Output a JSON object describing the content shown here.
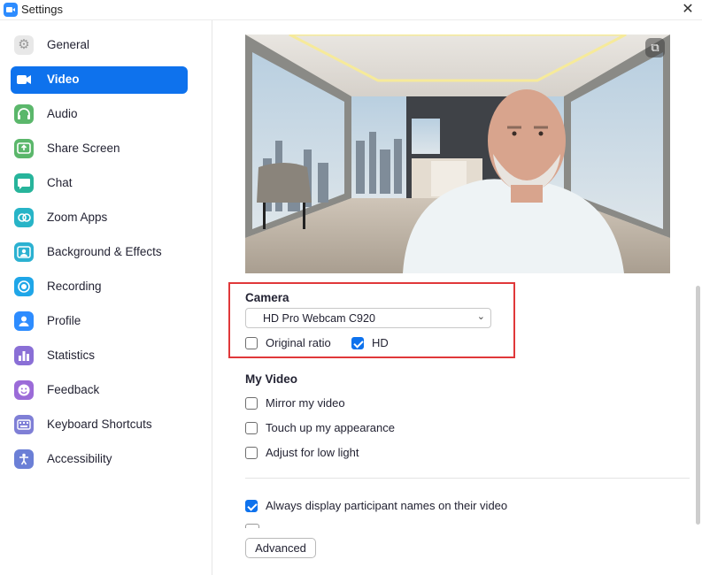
{
  "window": {
    "title": "Settings"
  },
  "sidebar": {
    "items": [
      {
        "label": "General",
        "icon": "gear-icon",
        "color": "#e8e8e8",
        "active": false
      },
      {
        "label": "Video",
        "icon": "video-camera-icon",
        "color": "#0e72ed",
        "active": true
      },
      {
        "label": "Audio",
        "icon": "headphones-icon",
        "color": "#5bb76b",
        "active": false
      },
      {
        "label": "Share Screen",
        "icon": "share-screen-icon",
        "color": "#5bb76b",
        "active": false
      },
      {
        "label": "Chat",
        "icon": "chat-bubble-icon",
        "color": "#27b49b",
        "active": false
      },
      {
        "label": "Zoom Apps",
        "icon": "apps-icon",
        "color": "#27b4c7",
        "active": false
      },
      {
        "label": "Background & Effects",
        "icon": "person-background-icon",
        "color": "#2bb1d1",
        "active": false
      },
      {
        "label": "Recording",
        "icon": "record-icon",
        "color": "#1fa6e8",
        "active": false
      },
      {
        "label": "Profile",
        "icon": "profile-icon",
        "color": "#2d8cff",
        "active": false
      },
      {
        "label": "Statistics",
        "icon": "bar-chart-icon",
        "color": "#8a6fd6",
        "active": false
      },
      {
        "label": "Feedback",
        "icon": "smiley-icon",
        "color": "#9b6bd8",
        "active": false
      },
      {
        "label": "Keyboard Shortcuts",
        "icon": "keyboard-icon",
        "color": "#7f7fd6",
        "active": false
      },
      {
        "label": "Accessibility",
        "icon": "accessibility-icon",
        "color": "#6b7fd6",
        "active": false
      }
    ]
  },
  "video": {
    "camera_title": "Camera",
    "camera_selected": "HD Pro Webcam C920",
    "original_ratio": {
      "label": "Original ratio",
      "checked": false
    },
    "hd": {
      "label": "HD",
      "checked": true
    },
    "my_video_title": "My Video",
    "mirror": {
      "label": "Mirror my video",
      "checked": false
    },
    "touch_up": {
      "label": "Touch up my appearance",
      "checked": false
    },
    "low_light": {
      "label": "Adjust for low light",
      "checked": false
    },
    "display_names": {
      "label": "Always display participant names on their video",
      "checked": true
    },
    "advanced_label": "Advanced"
  },
  "colors": {
    "accent": "#0e72ed",
    "highlight_border": "#e0383a"
  }
}
